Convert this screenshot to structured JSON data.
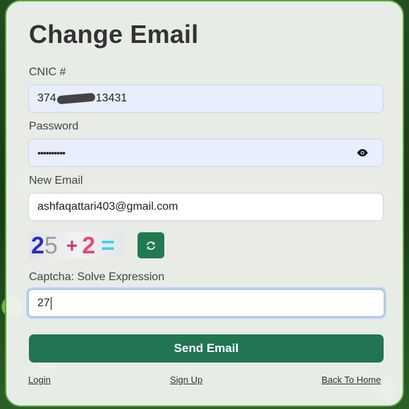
{
  "title": "Change Email",
  "cnic": {
    "label": "CNIC #",
    "value_start": "374",
    "value_end": "13431"
  },
  "password": {
    "label": "Password",
    "value": "••••••••••"
  },
  "new_email": {
    "label": "New Email",
    "value": "ashfaqattari403@gmail.com"
  },
  "captcha": {
    "digit1": "2",
    "digit2": "5",
    "plus": "+",
    "digit3": "2",
    "equals": "=",
    "label": "Captcha: Solve Expression",
    "answer": "27"
  },
  "send_button": "Send Email",
  "links": {
    "login": "Login",
    "signup": "Sign Up",
    "back": "Back To Home"
  },
  "colors": {
    "primary": "#217552",
    "field_bg": "#e8eefc",
    "border_green": "#58a83a"
  }
}
